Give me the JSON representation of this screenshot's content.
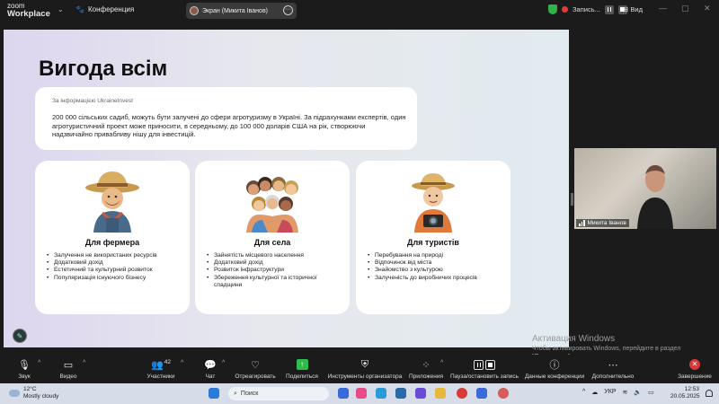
{
  "app": {
    "logo_line1": "zoom",
    "logo_line2": "Workplace",
    "meeting_label": "Конференция",
    "screen_share_label": "Экран (Микита Іванов)",
    "recording_label": "Запись...",
    "view_label": "Вид"
  },
  "slide": {
    "title": "Вигода всім",
    "info_source": "За інформацією UkraineInvest",
    "info_text": "200 000 сільських садиб, можуть бути залучені до сфери агротуризму в Україні. За підрахунками експертів, один агротуристичний проект може приносити, в середньому,  до 100 000 доларів США на рік, створюючи надзвичайно привабливу нішу для інвестицій.",
    "cards": [
      {
        "title": "Для фермера",
        "items": [
          "Залучення не використаних ресурсів",
          "Додатковий дохід",
          "Естетичний та культурний розвиток",
          "Популяризація існуючого бізнесу"
        ]
      },
      {
        "title": "Для села",
        "items": [
          "Зайнятість місцевого населення",
          "Додатковий дохід",
          "Розвиток інфраструктури",
          "Збереження культурної та історичної спадщини"
        ]
      },
      {
        "title": "Для туристів",
        "items": [
          "Перебування на природі",
          "Відпочинок від міста",
          "Знайомство з культурою",
          "Залученість до виробничих процесів"
        ]
      }
    ]
  },
  "video": {
    "participant_name": "Микита Іванов"
  },
  "windows_activation": {
    "title": "Активация Windows",
    "text": "Чтобы активировать Windows, перейдите в раздел \"Параметры\"."
  },
  "toolbar": {
    "audio": "Звук",
    "video": "Видео",
    "participants": "Участники",
    "participants_count": "42",
    "chat": "Чат",
    "react": "Отреагировать",
    "share": "Поделиться",
    "host_tools": "Инструменты организатора",
    "apps": "Приложения",
    "pause_stop": "Пауза/остановить запись",
    "meeting_info": "Данные конференции",
    "more": "Дополнительно",
    "end": "Завершение"
  },
  "taskbar": {
    "temperature": "12°C",
    "weather": "Mostly cloudy",
    "search_placeholder": "Поиск",
    "language": "УКР",
    "time": "12:53",
    "date": "20.05.2025"
  },
  "colors": {
    "accent_green": "#2fbd4a",
    "end_red": "#d93838",
    "record_red": "#e23b3b"
  }
}
